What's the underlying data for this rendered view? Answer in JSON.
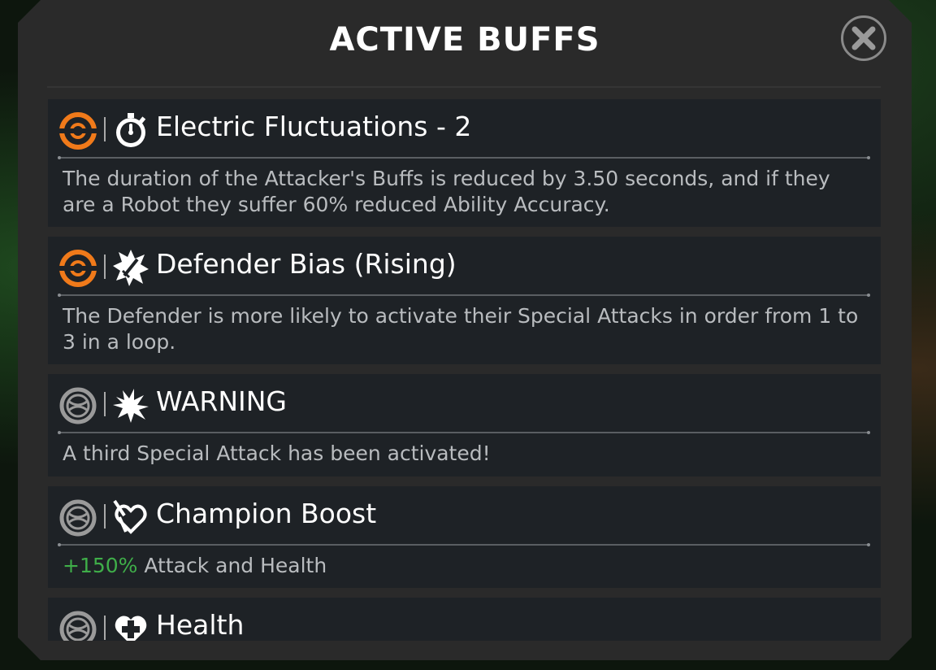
{
  "dialog": {
    "title": "ACTIVE BUFFS",
    "close_icon": "close-x-circle-icon"
  },
  "colors": {
    "panel": "#2a2a2a",
    "card": "#1e2226",
    "accent_orange": "#f07a1a",
    "value_green": "#3fae49",
    "text_muted": "#b9bcbf"
  },
  "buffs": [
    {
      "source_icon": "orange-target-icon",
      "type_icon": "stopwatch-icon",
      "name": "Electric Fluctuations - 2",
      "description": "The duration of the Attacker's Buffs is reduced by 3.50 seconds, and if they are a Robot they suffer 60% reduced Ability Accuracy."
    },
    {
      "source_icon": "orange-target-icon",
      "type_icon": "burst-sword-icon",
      "name": "Defender Bias (Rising)",
      "description": "The Defender is more likely to activate their Special Attacks in order from 1 to 3 in a loop."
    },
    {
      "source_icon": "gray-globe-icon",
      "type_icon": "explosion-icon",
      "name": "WARNING",
      "description": "A third Special Attack has been activated!"
    },
    {
      "source_icon": "gray-globe-icon",
      "type_icon": "heart-sword-icon",
      "name": "Champion Boost",
      "description_value": "+150%",
      "description": " Attack and Health"
    },
    {
      "source_icon": "gray-globe-icon",
      "type_icon": "heart-plus-icon",
      "name": "Health"
    }
  ]
}
